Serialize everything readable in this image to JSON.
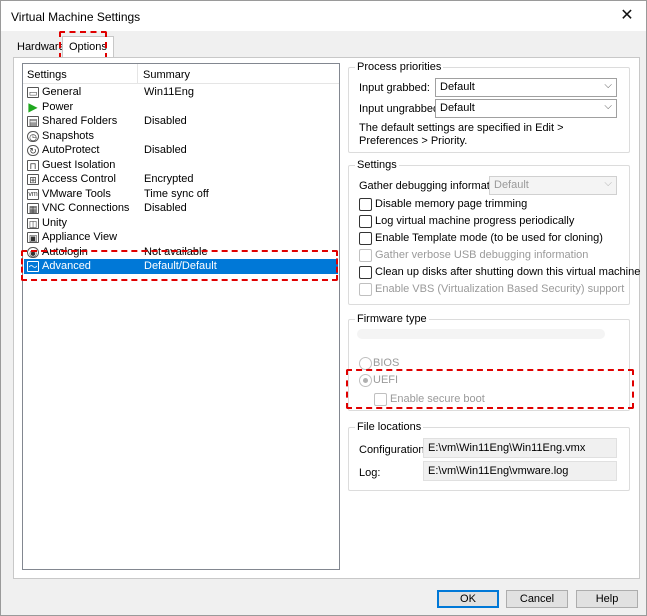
{
  "window": {
    "title": "Virtual Machine Settings"
  },
  "tabs": {
    "hardware": "Hardware",
    "options": "Options"
  },
  "list": {
    "col_settings": "Settings",
    "col_summary": "Summary",
    "rows": [
      {
        "icon": "monitor-icon",
        "label": "General",
        "summary": "Win11Eng"
      },
      {
        "icon": "power-icon",
        "label": "Power",
        "summary": ""
      },
      {
        "icon": "shared-folders-icon",
        "label": "Shared Folders",
        "summary": "Disabled"
      },
      {
        "icon": "snapshots-icon",
        "label": "Snapshots",
        "summary": ""
      },
      {
        "icon": "autoprotect-icon",
        "label": "AutoProtect",
        "summary": "Disabled"
      },
      {
        "icon": "lock-icon",
        "label": "Guest Isolation",
        "summary": ""
      },
      {
        "icon": "access-control-icon",
        "label": "Access Control",
        "summary": "Encrypted"
      },
      {
        "icon": "vmware-tools-icon",
        "label": "VMware Tools",
        "summary": "Time sync off"
      },
      {
        "icon": "vnc-icon",
        "label": "VNC Connections",
        "summary": "Disabled"
      },
      {
        "icon": "unity-icon",
        "label": "Unity",
        "summary": ""
      },
      {
        "icon": "appliance-icon",
        "label": "Appliance View",
        "summary": ""
      },
      {
        "icon": "autologin-icon",
        "label": "Autologin",
        "summary": "Not available"
      },
      {
        "icon": "advanced-icon",
        "label": "Advanced",
        "summary": "Default/Default"
      }
    ]
  },
  "process_priorities": {
    "title": "Process priorities",
    "grabbed_label": "Input grabbed:",
    "grabbed_value": "Default",
    "ungrabbed_label": "Input ungrabbed:",
    "ungrabbed_value": "Default",
    "note": "The default settings are specified in Edit > Preferences > Priority."
  },
  "settings": {
    "title": "Settings",
    "debug_label": "Gather debugging information:",
    "debug_value": "Default",
    "disable_memory": "Disable memory page trimming",
    "log_progress": "Log virtual machine progress periodically",
    "template_mode": "Enable Template mode (to be used for cloning)",
    "usb_debug": "Gather verbose USB debugging information",
    "cleanup_disks": "Clean up disks after shutting down this virtual machine",
    "enable_vbs": "Enable VBS (Virtualization Based Security) support"
  },
  "firmware": {
    "title": "Firmware type",
    "bios": "BIOS",
    "uefi": "UEFI",
    "secure_boot": "Enable secure boot"
  },
  "file_locations": {
    "title": "File locations",
    "config_label": "Configuration:",
    "config_value": "E:\\vm\\Win11Eng\\Win11Eng.vmx",
    "log_label": "Log:",
    "log_value": "E:\\vm\\Win11Eng\\vmware.log"
  },
  "buttons": {
    "ok": "OK",
    "cancel": "Cancel",
    "help": "Help"
  },
  "colors": {
    "selection": "#0078d7",
    "highlight": "#e00000"
  }
}
